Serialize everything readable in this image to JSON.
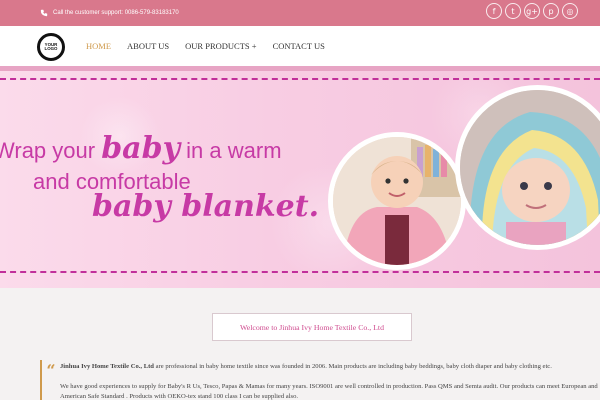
{
  "topbar": {
    "support_text": "Call the customer support: 0086-579-83183170",
    "social_icons": [
      "facebook-icon",
      "twitter-icon",
      "google-plus-icon",
      "pinterest-icon",
      "instagram-icon"
    ],
    "social_glyphs": [
      "f",
      "t",
      "g+",
      "p",
      "◎"
    ]
  },
  "header": {
    "logo_text": "YOUR LOGO",
    "nav": [
      "HOME",
      "ABOUT US",
      "OUR PRODUCTS +",
      "CONTACT US"
    ],
    "active_nav": "HOME"
  },
  "hero": {
    "line1_a": "Wrap your",
    "line1_b": "baby",
    "line1_c": "in a warm",
    "line2": "and comfortable",
    "line3": "baby blanket."
  },
  "welcome": {
    "title": "Welcome to Jinhua Ivy Home Textile Co., Ltd"
  },
  "intro": {
    "company": "Jinhua Ivy Home Textile Co., Ltd",
    "p1_rest": " are professional in baby home textile since was founded in 2006. Main products are including baby beddings, baby cloth diaper and baby clothing etc.",
    "p2": "We have good experiences to supply for Baby's R Us, Tesco, Papas & Mamas for many years. ISO9001 are well controlled in production. Pass QMS and Semta audit. Our products can meet European and American Safe Standard . Products with OEKO-tex stand 100 class I can be supplied also."
  },
  "colors": {
    "topbar": "#d9788c",
    "nav_active": "#cf9a4c",
    "hero_text": "#c73aa5",
    "dash": "#c12f9a"
  }
}
